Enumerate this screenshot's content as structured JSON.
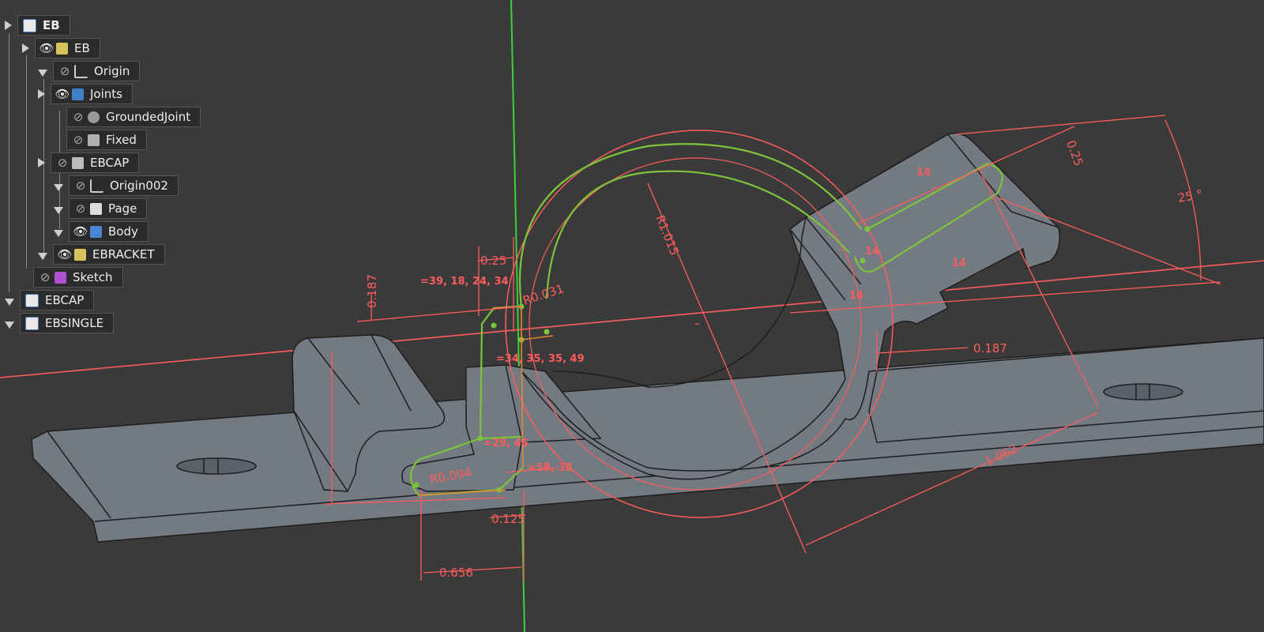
{
  "tree": {
    "items": [
      {
        "label": "EB",
        "icon": "document-icon",
        "expander": "collapsed",
        "eye": "",
        "bold": true
      },
      {
        "label": "EB",
        "icon": "part-icon",
        "expander": "collapsed",
        "eye": "visible"
      },
      {
        "label": "Origin",
        "icon": "origin-axes-icon",
        "expander": "expanded",
        "eye": "hidden"
      },
      {
        "label": "Joints",
        "icon": "joints-icon",
        "expander": "collapsed",
        "eye": "visible"
      },
      {
        "label": "GroundedJoint",
        "icon": "grounded-joint-icon",
        "expander": "",
        "eye": "hidden"
      },
      {
        "label": "Fixed",
        "icon": "fixed-joint-icon",
        "expander": "",
        "eye": "hidden"
      },
      {
        "label": "EBCAP",
        "icon": "linked-part-icon",
        "expander": "collapsed",
        "eye": "hidden"
      },
      {
        "label": "Origin002",
        "icon": "origin-axes-icon",
        "expander": "expanded",
        "eye": "hidden"
      },
      {
        "label": "Page",
        "icon": "page-icon",
        "expander": "expanded",
        "eye": "hidden"
      },
      {
        "label": "Body",
        "icon": "body-icon",
        "expander": "expanded",
        "eye": "visible"
      },
      {
        "label": "EBRACKET",
        "icon": "linked-part-icon",
        "expander": "expanded",
        "eye": "visible"
      },
      {
        "label": "Sketch",
        "icon": "sketch-icon",
        "expander": "",
        "eye": "hidden"
      },
      {
        "label": "EBCAP",
        "icon": "document-icon",
        "expander": "expanded",
        "eye": ""
      },
      {
        "label": "EBSINGLE",
        "icon": "document-icon",
        "expander": "expanded",
        "eye": ""
      }
    ]
  },
  "dims": {
    "d0187_left": "0.187",
    "d025_top": "0.25",
    "r0031": "R0.031",
    "c_top": "=39, 18, 24, 34",
    "c_mid": "=34, 35, 35, 49",
    "c_bot": "=58, 38",
    "c_bot2": "=29, 46",
    "r0094": "R0.094",
    "d0125": "0.125",
    "d0656": "0.656",
    "r1015": "R1.015",
    "d025_right": "0.25",
    "a25": "25 °",
    "d0187_right": "0.187",
    "d1062": "1.062",
    "c14a": "14",
    "c14b": "14",
    "c14c": "14",
    "c14d": "14"
  },
  "colors": {
    "background": "#3a3a3a",
    "part": "#737a82",
    "part_edge": "#1e1e1e",
    "constraint": "#ff5c5c",
    "sketch": "#7ec43a",
    "y_axis": "#3dcf3d"
  }
}
